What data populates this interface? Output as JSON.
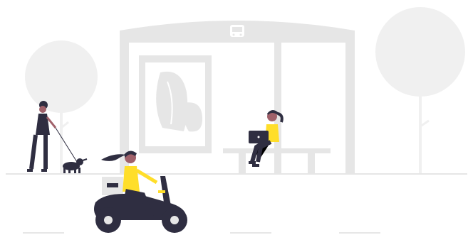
{
  "colors": {
    "background": "#ffffff",
    "light_gray": "#f0f0f0",
    "mid_gray": "#e6e6e6",
    "dark_gray": "#d6d6d6",
    "navy": "#2f2e41",
    "accent_yellow": "#ffde2a",
    "skin": "#a0616a",
    "hair": "#2f2e41"
  },
  "scene": {
    "elements": [
      "bus-stop-shelter",
      "bus-icon",
      "advertisement-poster",
      "bench",
      "woman-with-laptop",
      "woman-walking-dog",
      "dog",
      "woman-riding-scooter",
      "tree-left",
      "tree-right",
      "road-line"
    ]
  }
}
